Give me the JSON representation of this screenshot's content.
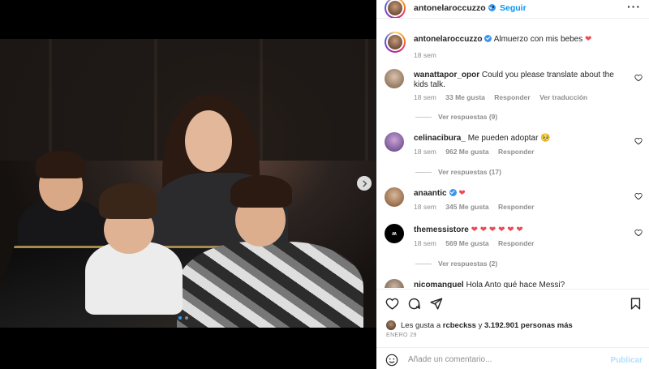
{
  "post": {
    "author": "antonelaroccuzzo",
    "follow_label": "Seguir",
    "separator": "•",
    "more_label": "···",
    "caption_text": "Almuerzo con mis bebes",
    "caption_emoji": "❤",
    "caption_time": "18 sem",
    "carousel": {
      "slides": 2,
      "current": 1
    }
  },
  "comments": [
    {
      "user": "wanattapor_opor",
      "text": "Could you please translate about the kids talk.",
      "time": "18 sem",
      "likes": "33 Me gusta",
      "reply": "Responder",
      "translate": "Ver traducción",
      "replies": "Ver respuestas (9)"
    },
    {
      "user": "celinacibura_",
      "text": "Me pueden adoptar 🥺",
      "time": "18 sem",
      "likes": "962 Me gusta",
      "reply": "Responder",
      "replies": "Ver respuestas (17)"
    },
    {
      "user": "anaantic",
      "text": "❤",
      "time": "18 sem",
      "likes": "345 Me gusta",
      "reply": "Responder"
    },
    {
      "user": "themessistore",
      "text": "❤ ❤ ❤ ❤ ❤ ❤",
      "time": "18 sem",
      "likes": "569 Me gusta",
      "reply": "Responder",
      "replies": "Ver respuestas (2)"
    },
    {
      "user": "nicomanguel",
      "text": "Hola Anto qué hace Messi?"
    }
  ],
  "likes": {
    "prefix": "Les gusta a",
    "user": "rcbeckss",
    "connector": "y",
    "count": "3.192.901 personas más"
  },
  "date": "ENERO 29",
  "composer": {
    "placeholder": "Añade un comentario...",
    "post_label": "Publicar"
  },
  "colors": {
    "accent": "#0095f6",
    "heart": "#ed4956",
    "verified": "#3897f0"
  }
}
